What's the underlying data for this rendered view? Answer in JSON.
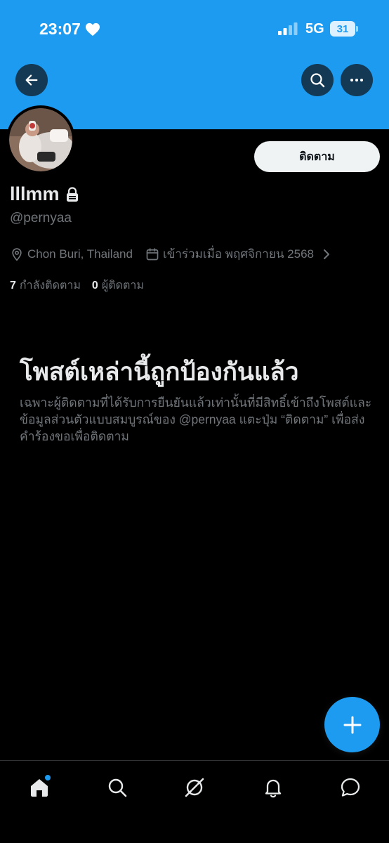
{
  "status_bar": {
    "time": "23:07",
    "network": "5G",
    "battery": "31"
  },
  "header": {
    "back_icon": "arrow-left-icon",
    "search_icon": "search-icon",
    "more_icon": "more-horizontal-icon"
  },
  "profile": {
    "display_name": "lllmm",
    "handle": "@pernyaa",
    "follow_label": "ติดตาม",
    "location": "Chon Buri, Thailand",
    "joined": "เข้าร่วมเมื่อ พฤศจิกายน 2568",
    "following_count": "7",
    "following_label": "กำลังติดตาม",
    "followers_count": "0",
    "followers_label": "ผู้ติดตาม"
  },
  "protected": {
    "title": "โพสต์เหล่านี้ถูกป้องกันแล้ว",
    "description": "เฉพาะผู้ติดตามที่ได้รับการยืนยันแล้วเท่านั้นที่มีสิทธิ์เข้าถึงโพสต์และข้อมูลส่วนตัวแบบสมบูรณ์ของ @pernyaa แตะปุ่ม “ติดตาม” เพื่อส่งคำร้องขอเพื่อติดตาม"
  },
  "fab": {
    "icon": "plus-icon"
  },
  "bottom_nav": {
    "items": [
      "home-icon",
      "search-icon",
      "grok-icon",
      "bell-icon",
      "chat-icon"
    ]
  },
  "colors": {
    "accent": "#1d9bf0",
    "background": "#000000",
    "text_primary": "#e7e9ea",
    "text_secondary": "#71767b"
  }
}
